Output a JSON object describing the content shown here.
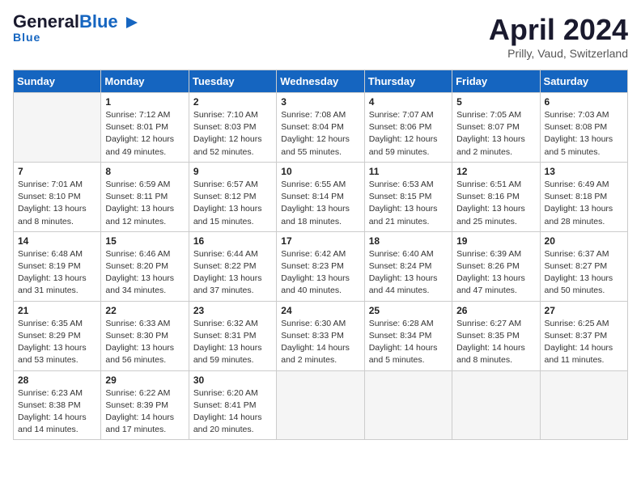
{
  "header": {
    "logo_general": "General",
    "logo_blue": "Blue",
    "month": "April 2024",
    "location": "Prilly, Vaud, Switzerland"
  },
  "days_of_week": [
    "Sunday",
    "Monday",
    "Tuesday",
    "Wednesday",
    "Thursday",
    "Friday",
    "Saturday"
  ],
  "weeks": [
    [
      {
        "day": "",
        "info": ""
      },
      {
        "day": "1",
        "info": "Sunrise: 7:12 AM\nSunset: 8:01 PM\nDaylight: 12 hours\nand 49 minutes."
      },
      {
        "day": "2",
        "info": "Sunrise: 7:10 AM\nSunset: 8:03 PM\nDaylight: 12 hours\nand 52 minutes."
      },
      {
        "day": "3",
        "info": "Sunrise: 7:08 AM\nSunset: 8:04 PM\nDaylight: 12 hours\nand 55 minutes."
      },
      {
        "day": "4",
        "info": "Sunrise: 7:07 AM\nSunset: 8:06 PM\nDaylight: 12 hours\nand 59 minutes."
      },
      {
        "day": "5",
        "info": "Sunrise: 7:05 AM\nSunset: 8:07 PM\nDaylight: 13 hours\nand 2 minutes."
      },
      {
        "day": "6",
        "info": "Sunrise: 7:03 AM\nSunset: 8:08 PM\nDaylight: 13 hours\nand 5 minutes."
      }
    ],
    [
      {
        "day": "7",
        "info": "Sunrise: 7:01 AM\nSunset: 8:10 PM\nDaylight: 13 hours\nand 8 minutes."
      },
      {
        "day": "8",
        "info": "Sunrise: 6:59 AM\nSunset: 8:11 PM\nDaylight: 13 hours\nand 12 minutes."
      },
      {
        "day": "9",
        "info": "Sunrise: 6:57 AM\nSunset: 8:12 PM\nDaylight: 13 hours\nand 15 minutes."
      },
      {
        "day": "10",
        "info": "Sunrise: 6:55 AM\nSunset: 8:14 PM\nDaylight: 13 hours\nand 18 minutes."
      },
      {
        "day": "11",
        "info": "Sunrise: 6:53 AM\nSunset: 8:15 PM\nDaylight: 13 hours\nand 21 minutes."
      },
      {
        "day": "12",
        "info": "Sunrise: 6:51 AM\nSunset: 8:16 PM\nDaylight: 13 hours\nand 25 minutes."
      },
      {
        "day": "13",
        "info": "Sunrise: 6:49 AM\nSunset: 8:18 PM\nDaylight: 13 hours\nand 28 minutes."
      }
    ],
    [
      {
        "day": "14",
        "info": "Sunrise: 6:48 AM\nSunset: 8:19 PM\nDaylight: 13 hours\nand 31 minutes."
      },
      {
        "day": "15",
        "info": "Sunrise: 6:46 AM\nSunset: 8:20 PM\nDaylight: 13 hours\nand 34 minutes."
      },
      {
        "day": "16",
        "info": "Sunrise: 6:44 AM\nSunset: 8:22 PM\nDaylight: 13 hours\nand 37 minutes."
      },
      {
        "day": "17",
        "info": "Sunrise: 6:42 AM\nSunset: 8:23 PM\nDaylight: 13 hours\nand 40 minutes."
      },
      {
        "day": "18",
        "info": "Sunrise: 6:40 AM\nSunset: 8:24 PM\nDaylight: 13 hours\nand 44 minutes."
      },
      {
        "day": "19",
        "info": "Sunrise: 6:39 AM\nSunset: 8:26 PM\nDaylight: 13 hours\nand 47 minutes."
      },
      {
        "day": "20",
        "info": "Sunrise: 6:37 AM\nSunset: 8:27 PM\nDaylight: 13 hours\nand 50 minutes."
      }
    ],
    [
      {
        "day": "21",
        "info": "Sunrise: 6:35 AM\nSunset: 8:29 PM\nDaylight: 13 hours\nand 53 minutes."
      },
      {
        "day": "22",
        "info": "Sunrise: 6:33 AM\nSunset: 8:30 PM\nDaylight: 13 hours\nand 56 minutes."
      },
      {
        "day": "23",
        "info": "Sunrise: 6:32 AM\nSunset: 8:31 PM\nDaylight: 13 hours\nand 59 minutes."
      },
      {
        "day": "24",
        "info": "Sunrise: 6:30 AM\nSunset: 8:33 PM\nDaylight: 14 hours\nand 2 minutes."
      },
      {
        "day": "25",
        "info": "Sunrise: 6:28 AM\nSunset: 8:34 PM\nDaylight: 14 hours\nand 5 minutes."
      },
      {
        "day": "26",
        "info": "Sunrise: 6:27 AM\nSunset: 8:35 PM\nDaylight: 14 hours\nand 8 minutes."
      },
      {
        "day": "27",
        "info": "Sunrise: 6:25 AM\nSunset: 8:37 PM\nDaylight: 14 hours\nand 11 minutes."
      }
    ],
    [
      {
        "day": "28",
        "info": "Sunrise: 6:23 AM\nSunset: 8:38 PM\nDaylight: 14 hours\nand 14 minutes."
      },
      {
        "day": "29",
        "info": "Sunrise: 6:22 AM\nSunset: 8:39 PM\nDaylight: 14 hours\nand 17 minutes."
      },
      {
        "day": "30",
        "info": "Sunrise: 6:20 AM\nSunset: 8:41 PM\nDaylight: 14 hours\nand 20 minutes."
      },
      {
        "day": "",
        "info": ""
      },
      {
        "day": "",
        "info": ""
      },
      {
        "day": "",
        "info": ""
      },
      {
        "day": "",
        "info": ""
      }
    ]
  ]
}
